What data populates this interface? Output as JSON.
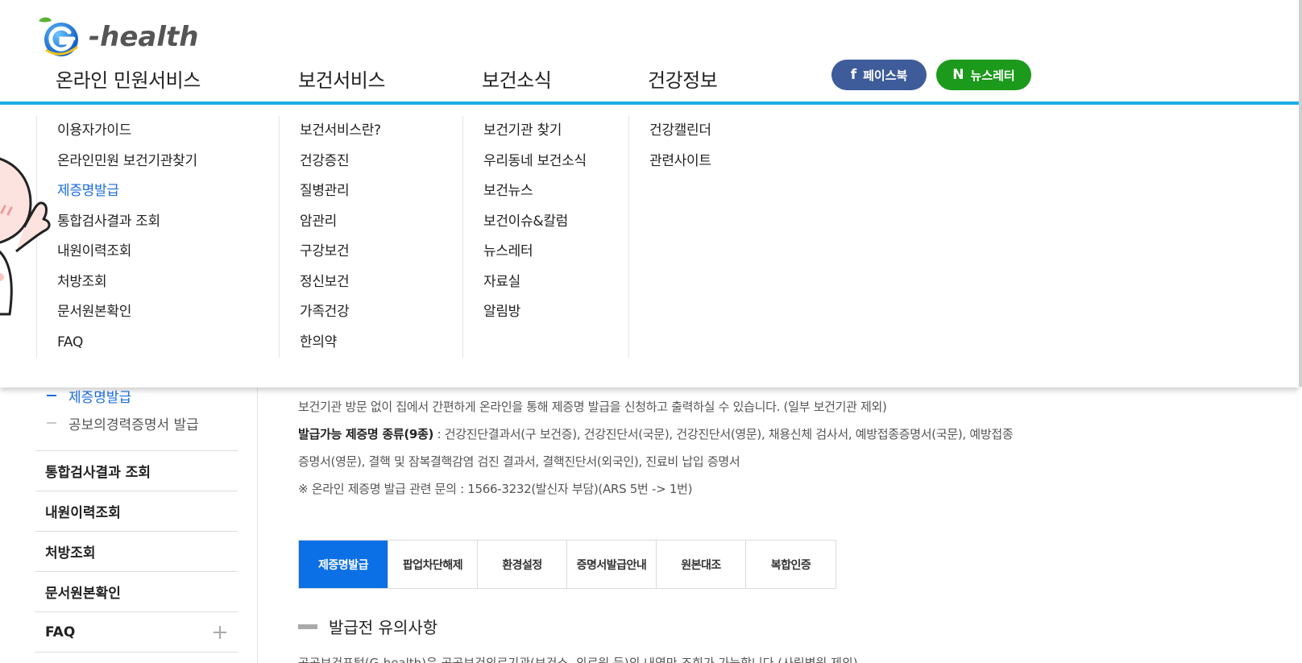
{
  "logo": {
    "text": "-health",
    "icon": "g-health-logo"
  },
  "gnb": [
    "온라인 민원서비스",
    "보건서비스",
    "보건소식",
    "건강정보"
  ],
  "sns": {
    "facebook": {
      "icon": "f",
      "label": "페이스북",
      "color": "#3e5c9a"
    },
    "newsletter": {
      "icon": "N",
      "label": "뉴스레터",
      "color": "#1b9a1b"
    }
  },
  "megamenu": {
    "col1": [
      "이용자가이드",
      "온라인민원 보건기관찾기",
      "제증명발급",
      "통합검사결과 조회",
      "내원이력조회",
      "처방조회",
      "문서원본확인",
      "FAQ"
    ],
    "col2": [
      "보건서비스란?",
      "건강증진",
      "질병관리",
      "암관리",
      "구강보건",
      "정신보건",
      "가족건강",
      "한의약"
    ],
    "col3": [
      "보건기관 찾기",
      "우리동네 보건소식",
      "보건뉴스",
      "보건이슈&칼럼",
      "뉴스레터",
      "자료실",
      "알림방"
    ],
    "col4": [
      "건강캘린더",
      "관련사이트"
    ],
    "active_item": "제증명발급"
  },
  "lnb": {
    "sub_items": [
      "제증명발급",
      "공보의경력증명서 발급"
    ],
    "items": [
      "통합검사결과 조회",
      "내원이력조회",
      "처방조회",
      "문서원본확인",
      "FAQ"
    ]
  },
  "content": {
    "intro": "보건기관 방문 없이 집에서 간편하게 온라인을 통해 제증명 발급을 신청하고 출력하실 수 있습니다. (일부 보건기관 제외)",
    "types_label": "발급가능 제증명 종류(9종)",
    "types_text": " : 건강진단결과서(구 보건증), 건강진단서(국문), 건강진단서(영문), 채용신체 검사서, 예방접종증명서(국문), 예방접종증명서(영문), 결핵 및 잠복결핵감염 검진 결과서, 결핵진단서(외국인), 진료비 납입 증명서",
    "contact": "※ 온라인 제증명 발급 관련 문의 : 1566-3232(발신자 부담)(ARS 5번 -> 1번)"
  },
  "tabs": [
    "제증명발급",
    "팝업차단해제",
    "환경설정",
    "증명서발급안내",
    "원본대조",
    "복합인증"
  ],
  "section_title": "발급전 유의사항",
  "cut_line": "공공보건포털(G-health)은 공공보건의료기관(보건소, 의료원 등)의 내역만 조회가 가능합니다.(사립병원 제외)",
  "colors": {
    "accent": "#19aee6",
    "active": "#1a6ddc",
    "tab_active": "#0b6fe6"
  }
}
